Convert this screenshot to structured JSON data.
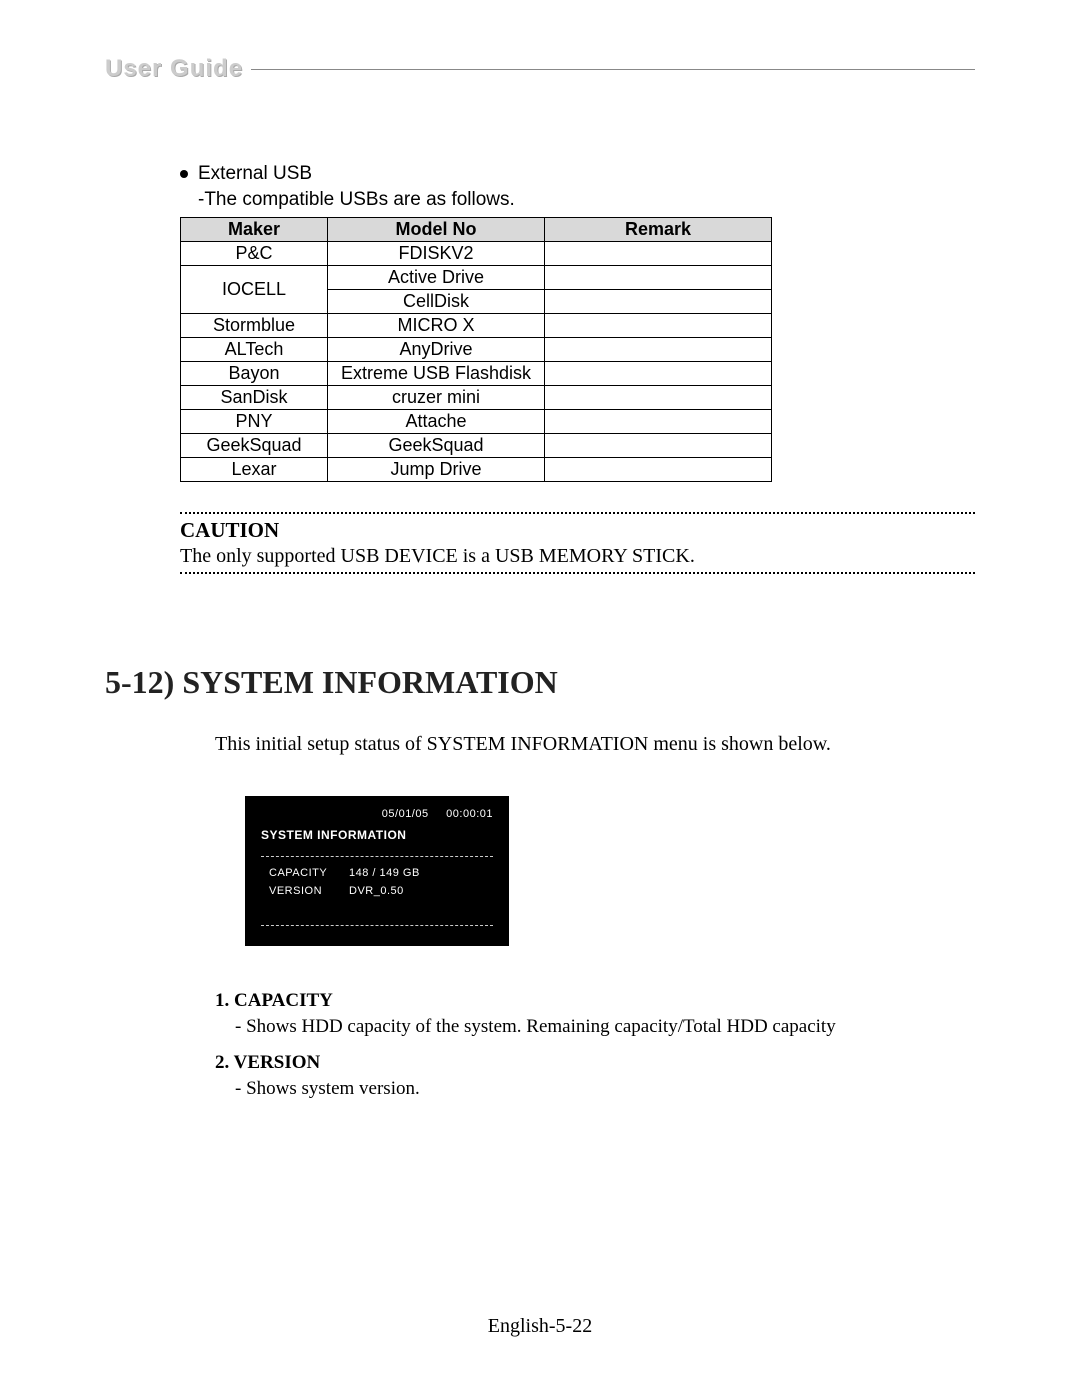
{
  "header_title": "User Guide",
  "bullet_title": "External USB",
  "bullet_sub": "-The compatible USBs are as follows.",
  "table": {
    "headers": {
      "maker": "Maker",
      "model": "Model No",
      "remark": "Remark"
    },
    "rows": [
      {
        "maker": "P&C",
        "model": "FDISKV2",
        "remark": ""
      },
      {
        "maker": "IOCELL",
        "model": "Active Drive",
        "remark": "",
        "rowspan": 2
      },
      {
        "maker": "",
        "model": "CellDisk",
        "remark": ""
      },
      {
        "maker": "Stormblue",
        "model": "MICRO X",
        "remark": ""
      },
      {
        "maker": "ALTech",
        "model": "AnyDrive",
        "remark": ""
      },
      {
        "maker": "Bayon",
        "model": "Extreme USB Flashdisk",
        "remark": ""
      },
      {
        "maker": "SanDisk",
        "model": "cruzer mini",
        "remark": ""
      },
      {
        "maker": "PNY",
        "model": "Attache",
        "remark": ""
      },
      {
        "maker": "GeekSquad",
        "model": "GeekSquad",
        "remark": ""
      },
      {
        "maker": "Lexar",
        "model": "Jump Drive",
        "remark": ""
      }
    ]
  },
  "caution_title": "CAUTION",
  "caution_text": "The only supported USB DEVICE is a USB MEMORY STICK.",
  "section_heading": "5-12) SYSTEM INFORMATION",
  "intro_text": "This initial setup status of SYSTEM INFORMATION menu is shown below.",
  "screen": {
    "date": "05/01/05",
    "time": "00:00:01",
    "title": "SYSTEM INFORMATION",
    "rows": [
      {
        "label": "CAPACITY",
        "value": "148 / 149 GB"
      },
      {
        "label": "VERSION",
        "value": "DVR_0.50"
      }
    ]
  },
  "numbered": [
    {
      "head": "1.  CAPACITY",
      "body": "- Shows HDD capacity of the system. Remaining capacity/Total HDD capacity"
    },
    {
      "head": "2.  VERSION",
      "body": "- Shows system version."
    }
  ],
  "footer": "English-5-22",
  "chart_data": {
    "type": "table",
    "title": "Compatible USB devices",
    "columns": [
      "Maker",
      "Model No",
      "Remark"
    ],
    "rows": [
      [
        "P&C",
        "FDISKV2",
        ""
      ],
      [
        "IOCELL",
        "Active Drive",
        ""
      ],
      [
        "IOCELL",
        "CellDisk",
        ""
      ],
      [
        "Stormblue",
        "MICRO X",
        ""
      ],
      [
        "ALTech",
        "AnyDrive",
        ""
      ],
      [
        "Bayon",
        "Extreme USB Flashdisk",
        ""
      ],
      [
        "SanDisk",
        "cruzer mini",
        ""
      ],
      [
        "PNY",
        "Attache",
        ""
      ],
      [
        "GeekSquad",
        "GeekSquad",
        ""
      ],
      [
        "Lexar",
        "Jump Drive",
        ""
      ]
    ]
  }
}
